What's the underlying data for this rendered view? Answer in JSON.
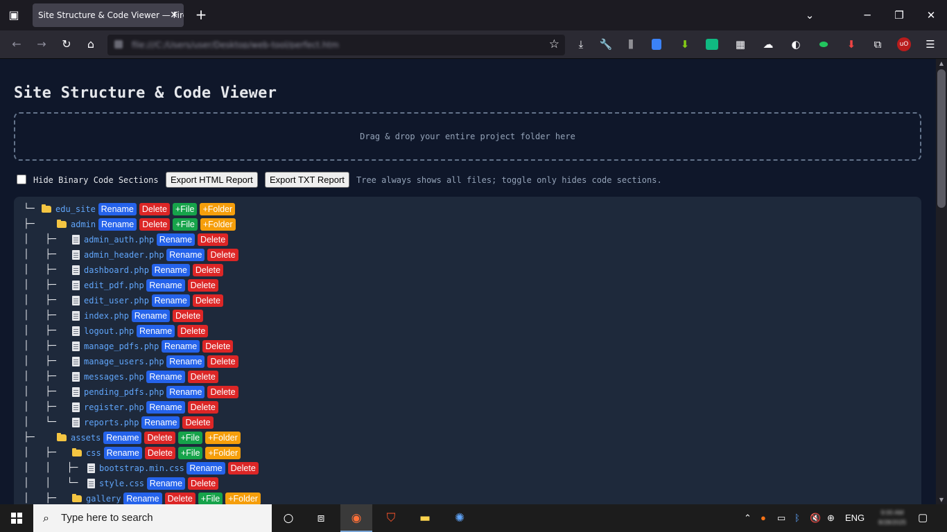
{
  "browser": {
    "tab_title": "Site Structure & Code Viewer — Firefox",
    "url": "file:///C:/Users/user/Desktop/web-tool/perfect.html"
  },
  "page": {
    "title": "Site Structure & Code Viewer",
    "dropzone_text": "Drag & drop your entire project folder here",
    "hide_binary_label": "Hide Binary Code Sections",
    "hide_binary_checked": false,
    "export_html_label": "Export HTML Report",
    "export_txt_label": "Export TXT Report",
    "hint": "Tree always shows all files; toggle only hides code sections."
  },
  "actions": {
    "rename": "Rename",
    "delete": "Delete",
    "add_file": "+File",
    "add_folder": "+Folder"
  },
  "tree": [
    {
      "type": "folder",
      "name": "edu_site",
      "prefix": "└─"
    },
    {
      "type": "folder",
      "name": "admin",
      "prefix": "├─",
      "depth": 1
    },
    {
      "type": "file",
      "name": "admin_auth.php",
      "prefix": "│ ├─",
      "depth": 2
    },
    {
      "type": "file",
      "name": "admin_header.php",
      "prefix": "│ ├─",
      "depth": 2
    },
    {
      "type": "file",
      "name": "dashboard.php",
      "prefix": "│ ├─",
      "depth": 2
    },
    {
      "type": "file",
      "name": "edit_pdf.php",
      "prefix": "│ ├─",
      "depth": 2
    },
    {
      "type": "file",
      "name": "edit_user.php",
      "prefix": "│ ├─",
      "depth": 2
    },
    {
      "type": "file",
      "name": "index.php",
      "prefix": "│ ├─",
      "depth": 2
    },
    {
      "type": "file",
      "name": "logout.php",
      "prefix": "│ ├─",
      "depth": 2
    },
    {
      "type": "file",
      "name": "manage_pdfs.php",
      "prefix": "│ ├─",
      "depth": 2
    },
    {
      "type": "file",
      "name": "manage_users.php",
      "prefix": "│ ├─",
      "depth": 2
    },
    {
      "type": "file",
      "name": "messages.php",
      "prefix": "│ ├─",
      "depth": 2
    },
    {
      "type": "file",
      "name": "pending_pdfs.php",
      "prefix": "│ ├─",
      "depth": 2
    },
    {
      "type": "file",
      "name": "register.php",
      "prefix": "│ ├─",
      "depth": 2
    },
    {
      "type": "file",
      "name": "reports.php",
      "prefix": "│ └─",
      "depth": 2
    },
    {
      "type": "folder",
      "name": "assets",
      "prefix": "├─",
      "depth": 1
    },
    {
      "type": "folder",
      "name": "css",
      "prefix": "│ ├─",
      "depth": 2
    },
    {
      "type": "file",
      "name": "bootstrap.min.css",
      "prefix": "│ │ ├─",
      "depth": 3
    },
    {
      "type": "file",
      "name": "style.css",
      "prefix": "│ │ └─",
      "depth": 3
    },
    {
      "type": "folder",
      "name": "gallery",
      "prefix": "│ ├─",
      "depth": 2
    }
  ],
  "taskbar": {
    "search_placeholder": "Type here to search",
    "language": "ENG"
  }
}
